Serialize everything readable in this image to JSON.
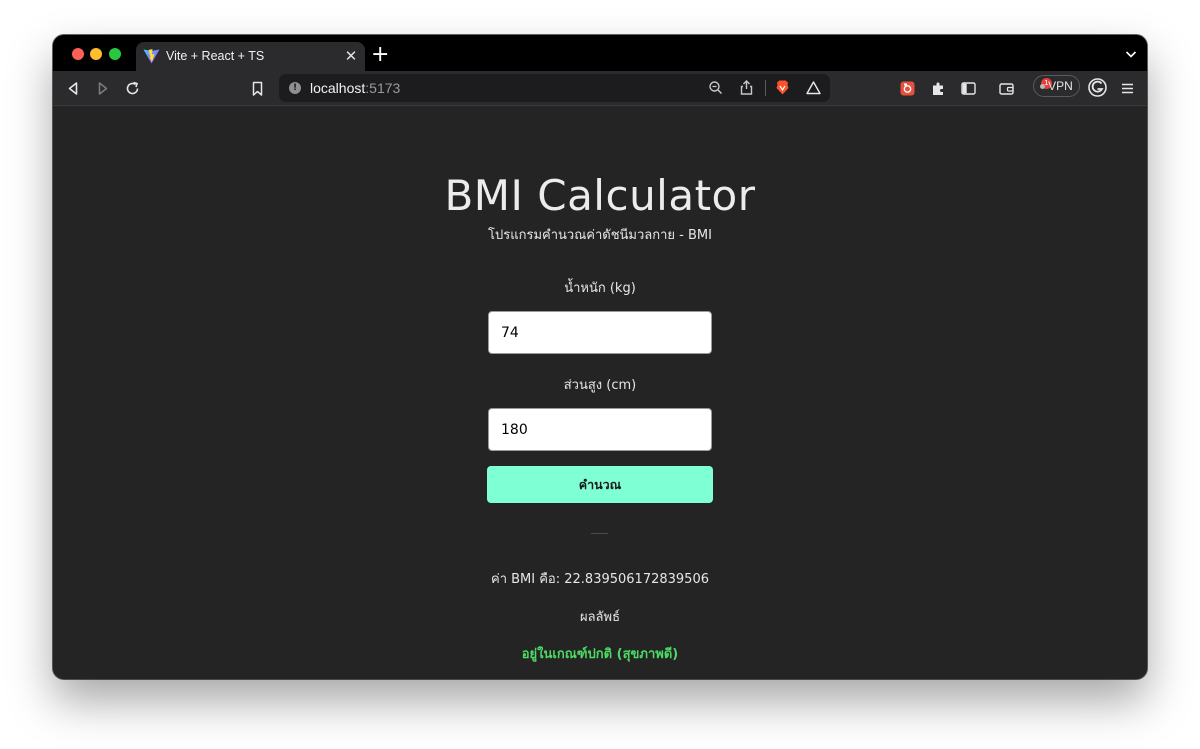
{
  "browser": {
    "tab_title": "Vite + React + TS",
    "url_host": "localhost",
    "url_port": ":5173",
    "notification_count": "1",
    "vpn_label": "VPN"
  },
  "app": {
    "title": "BMI Calculator",
    "subtitle": "โปรแกรมคำนวณค่าดัชนีมวลกาย - BMI",
    "weight_label": "น้ำหนัก (kg)",
    "weight_value": "74",
    "height_label": "ส่วนสูง (cm)",
    "height_value": "180",
    "calculate_label": "คำนวณ",
    "result_text": "ค่า BMI คือ: 22.839506172839506",
    "result_heading": "ผลลัพธ์",
    "result_status": "อยู่ในเกณฑ์ปกติ (สุขภาพดี)",
    "status_color": "#4cd964",
    "accent_color": "#7fffd4"
  }
}
